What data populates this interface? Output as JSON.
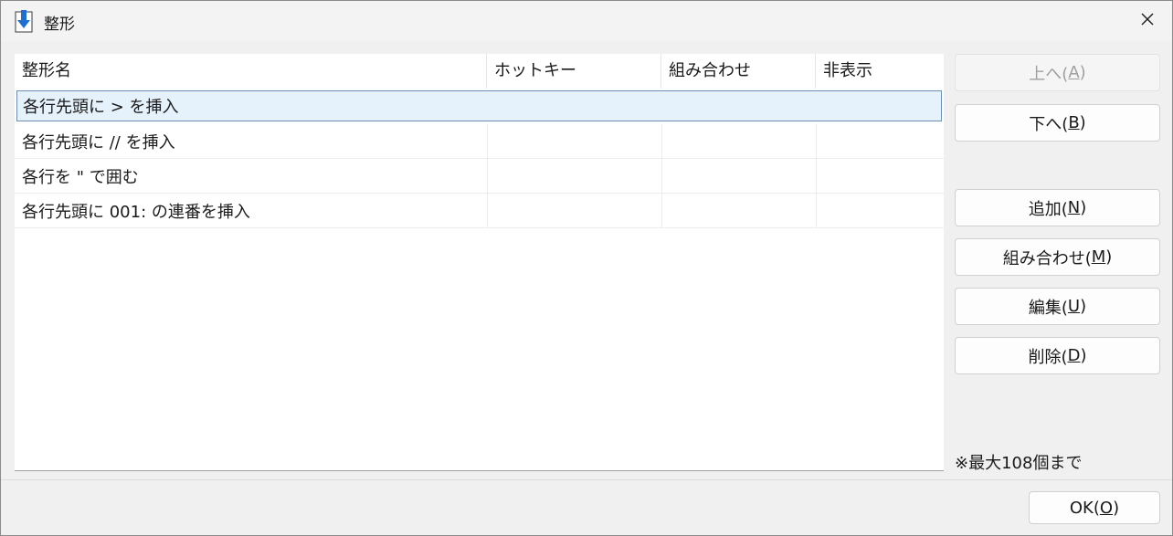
{
  "window": {
    "title": "整形"
  },
  "list": {
    "columns": [
      "整形名",
      "ホットキー",
      "組み合わせ",
      "非表示"
    ],
    "rows": [
      {
        "name": "各行先頭に > を挿入",
        "hotkey": "",
        "combo": "",
        "hidden": "",
        "selected": true
      },
      {
        "name": "各行先頭に // を挿入",
        "hotkey": "",
        "combo": "",
        "hidden": ""
      },
      {
        "name": "各行を \" で囲む",
        "hotkey": "",
        "combo": "",
        "hidden": ""
      },
      {
        "name": "各行先頭に 001: の連番を挿入",
        "hotkey": "",
        "combo": "",
        "hidden": ""
      }
    ]
  },
  "buttons": {
    "up": {
      "label": "上へ(",
      "key": "A",
      "end": ")",
      "enabled": false
    },
    "down": {
      "label": "下へ(",
      "key": "B",
      "end": ")"
    },
    "add": {
      "label": "追加(",
      "key": "N",
      "end": ")"
    },
    "combine": {
      "label": "組み合わせ(",
      "key": "M",
      "end": ")"
    },
    "edit": {
      "label": "編集(",
      "key": "U",
      "end": ")"
    },
    "delete": {
      "label": "削除(",
      "key": "D",
      "end": ")"
    },
    "ok": {
      "label": "OK(",
      "key": "O",
      "end": ")"
    }
  },
  "note": "※最大108個まで",
  "icons": {
    "app": "download-arrow-icon",
    "close": "close-icon"
  },
  "colors": {
    "selection_bg": "#e5f1fb",
    "selection_border": "#6b8fb3",
    "icon_blue": "#1f6fd1"
  }
}
